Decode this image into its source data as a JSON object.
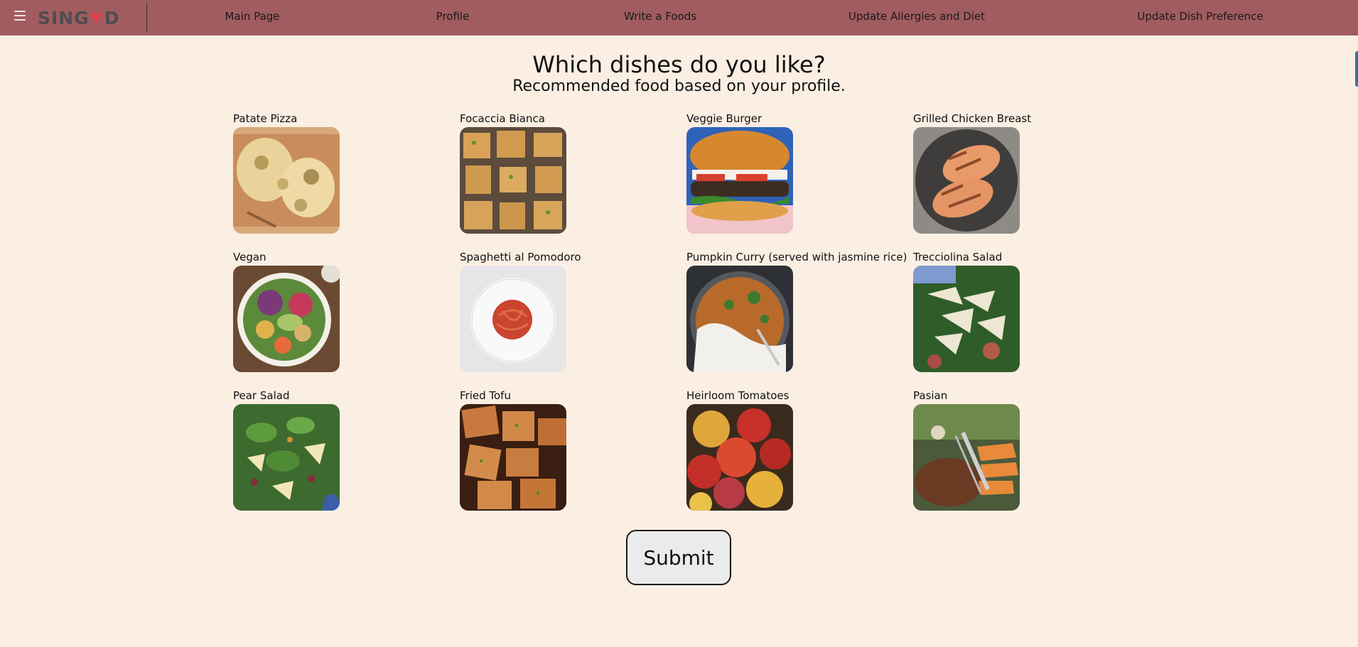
{
  "header": {
    "logo": {
      "left": "SING",
      "heart": "♥",
      "right": "D"
    },
    "nav": [
      {
        "label": "Main Page",
        "name": "nav-main-page"
      },
      {
        "label": "Profile",
        "name": "nav-profile"
      },
      {
        "label": "Write a Foods",
        "name": "nav-write-a-foods"
      },
      {
        "label": "Update Allergies and Diet",
        "name": "nav-update-allergies-diet"
      },
      {
        "label": "Update Dish Preference",
        "name": "nav-update-dish-preference"
      }
    ]
  },
  "main": {
    "title": "Which dishes do you like?",
    "subtitle": "Recommended food based on your profile.",
    "dishes": [
      {
        "name": "Patate Pizza",
        "photo": "potato-pizza-photo"
      },
      {
        "name": "Focaccia Bianca",
        "photo": "focaccia-photo"
      },
      {
        "name": "Veggie Burger",
        "photo": "veggie-burger-photo"
      },
      {
        "name": "Grilled Chicken Breast",
        "photo": "grilled-chicken-photo"
      },
      {
        "name": "Vegan",
        "photo": "vegan-bowl-photo"
      },
      {
        "name": "Spaghetti al Pomodoro",
        "photo": "spaghetti-photo"
      },
      {
        "name": "Pumpkin Curry (served with jasmine rice)",
        "photo": "pumpkin-curry-photo"
      },
      {
        "name": "Trecciolina Salad",
        "photo": "trecciolina-salad-photo"
      },
      {
        "name": "Pear Salad",
        "photo": "pear-salad-photo"
      },
      {
        "name": "Fried Tofu",
        "photo": "fried-tofu-photo"
      },
      {
        "name": "Heirloom Tomatoes",
        "photo": "heirloom-tomatoes-photo"
      },
      {
        "name": "Pasian",
        "photo": "pasian-photo"
      }
    ],
    "submit_label": "Submit"
  },
  "colors": {
    "nav_bg": "#a15c5f",
    "page_bg": "#fbeee3",
    "heart": "#e0424c"
  }
}
